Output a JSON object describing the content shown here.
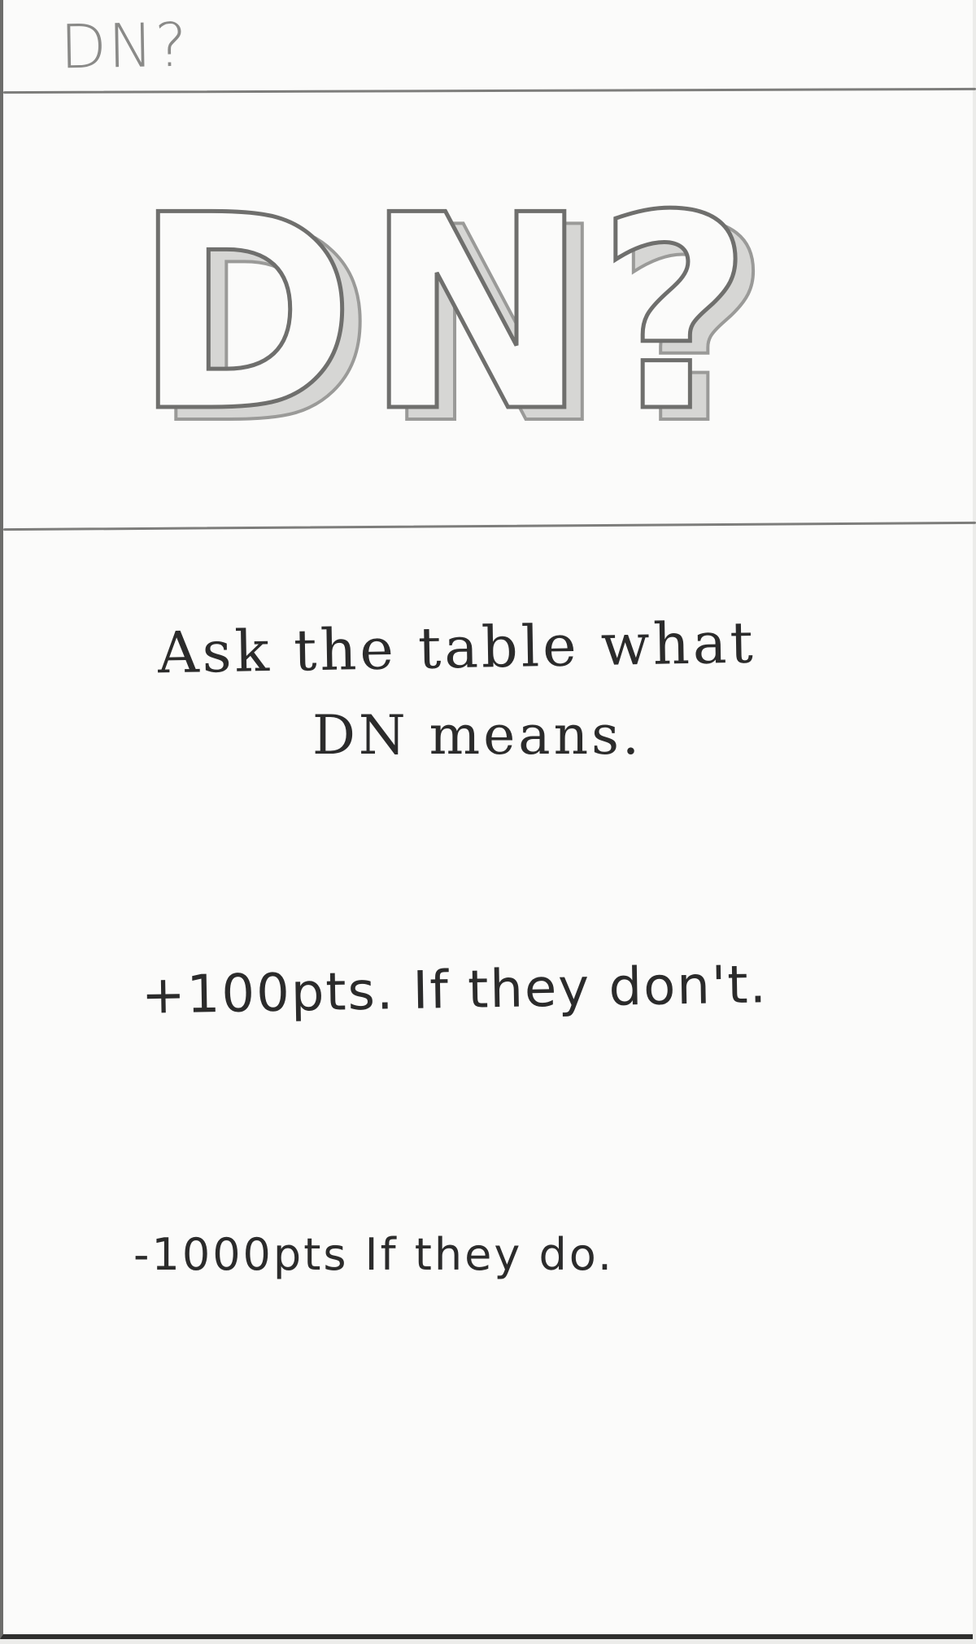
{
  "card": {
    "header_label": "DN?",
    "title": "DN?",
    "prompt_line1": "Ask the table what",
    "prompt_line2": "DN means.",
    "reward": "+100pts. If they don't.",
    "penalty": "-1000pts If they do."
  }
}
